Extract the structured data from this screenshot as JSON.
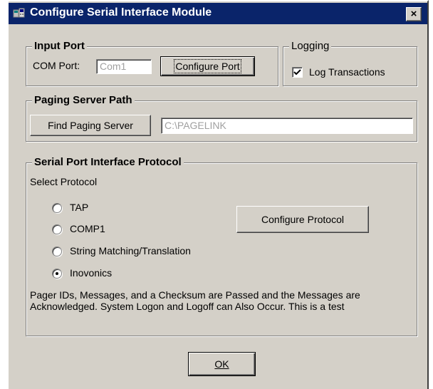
{
  "window": {
    "title": "Configure Serial Interface Module",
    "close_label": "×",
    "app_icon": "pagelink-app-icon",
    "title_bar_color": "#0a246a",
    "face_color": "#d4d0c8"
  },
  "input_port": {
    "legend": "Input Port",
    "com_port_label": "COM Port:",
    "com_port_value": "Com1",
    "configure_port_label": "Configure Port"
  },
  "logging": {
    "legend": "Logging",
    "log_transactions_label": "Log Transactions",
    "log_transactions_checked": true
  },
  "paging_server": {
    "legend": "Paging Server Path",
    "find_button_label": "Find Paging Server",
    "path_value": "C:\\PAGELINK"
  },
  "protocol": {
    "legend": "Serial Port Interface Protocol",
    "select_label": "Select Protocol",
    "options": [
      {
        "label": "TAP",
        "selected": false
      },
      {
        "label": "COMP1",
        "selected": false
      },
      {
        "label": "String Matching/Translation",
        "selected": false
      },
      {
        "label": "Inovonics",
        "selected": true
      }
    ],
    "configure_protocol_label": "Configure Protocol",
    "description": "Pager IDs,  Messages, and a Checksum are Passed and the Messages are Acknowledged.  System Logon and Logoff can Also Occur. This is a test"
  },
  "footer": {
    "ok_label": "OK"
  }
}
